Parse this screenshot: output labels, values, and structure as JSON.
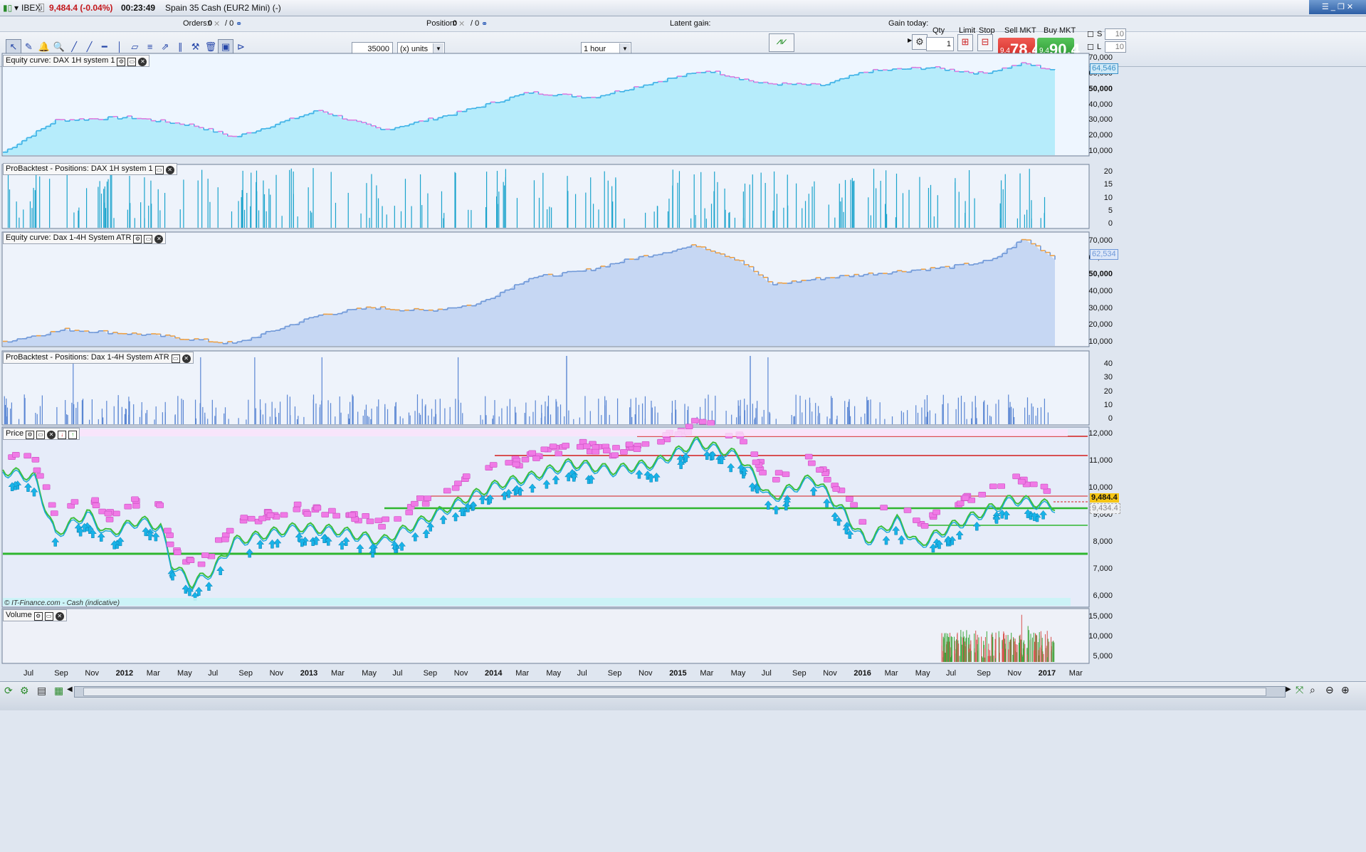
{
  "window": {
    "title_symbol": "IBEX",
    "price": "9,484.4 (-0.04%)",
    "time": "00:23:49",
    "instrument": "Spain 35 Cash (EUR2 Mini) (-)"
  },
  "info": {
    "orders_label": "Orders:",
    "orders_value": "0",
    "orders_sep": "/ 0",
    "position_label": "Position:",
    "position_value": "0",
    "position_sep": "/ 0",
    "latent_label": "Latent gain:",
    "latent_value": "-",
    "gain_label": "Gain today:",
    "gain_value": "-"
  },
  "toolbar": {
    "tools": [
      "pointer-tool",
      "eraser-tool",
      "alarm-tool",
      "zoom-tool",
      "line-tool",
      "trendline-tool",
      "horizontal-line-tool",
      "vertical-line-tool",
      "channel-tool",
      "fibonacci-tool",
      "arrows-tool",
      "parallel-tool",
      "magnet-tool",
      "delete-tool",
      "indicator-tool",
      "signal-tool"
    ],
    "units_value": "35000",
    "units_mode": "(x) units",
    "timeframe": "1 hour",
    "qty_label": "Qty",
    "qty_value": "1",
    "limit_label": "Limit",
    "stop_label": "Stop",
    "sell_label": "Sell MKT",
    "sell_small": "9,4",
    "sell_big": "78.4",
    "buy_label": "Buy MKT",
    "buy_small": "9,4",
    "buy_big": "90.4",
    "s_label": "S",
    "s_value": "10",
    "l_label": "L",
    "l_value": "10"
  },
  "panels": {
    "equity1": {
      "label": "Equity curve: DAX 1H system 1",
      "y_ticks": [
        "70,000",
        "60,000",
        "50,000",
        "40,000",
        "30,000",
        "20,000",
        "10,000"
      ],
      "last": "64,546",
      "line_color": "#3cb0e6",
      "fill_color": "#b6ecfb",
      "down_color": "#e07adf"
    },
    "positions1": {
      "label": "ProBacktest - Positions: DAX 1H system 1",
      "y_ticks": [
        "20",
        "15",
        "10",
        "5",
        "0"
      ],
      "bar_color": "#1aa3cc"
    },
    "equity2": {
      "label": "Equity curve: Dax 1-4H System ATR",
      "y_ticks": [
        "70,000",
        "60,000",
        "50,000",
        "40,000",
        "30,000",
        "20,000",
        "10,000"
      ],
      "last": "62,534",
      "line_color": "#6f98d8",
      "fill_color": "#c6d7f3",
      "down_color": "#f0a040"
    },
    "positions2": {
      "label": "ProBacktest - Positions: Dax 1-4H System ATR",
      "y_ticks": [
        "40",
        "30",
        "20",
        "10",
        "0"
      ],
      "bar_color": "#5a86d3"
    },
    "price": {
      "label": "Price",
      "y_ticks": [
        "12,000",
        "11,000",
        "10,000",
        "9,000",
        "8,000",
        "7,000",
        "6,000"
      ],
      "last": "9,484.4",
      "last2": "9,434.4",
      "footer": "© IT-Finance.com - Cash (indicative)"
    },
    "volume": {
      "label": "Volume",
      "y_ticks": [
        "15,000",
        "10,000",
        "5,000"
      ]
    }
  },
  "x_axis": [
    {
      "t": "Jul",
      "yr": false
    },
    {
      "t": "Sep",
      "yr": false
    },
    {
      "t": "Nov",
      "yr": false
    },
    {
      "t": "2012",
      "yr": true
    },
    {
      "t": "Mar",
      "yr": false
    },
    {
      "t": "May",
      "yr": false
    },
    {
      "t": "Jul",
      "yr": false
    },
    {
      "t": "Sep",
      "yr": false
    },
    {
      "t": "Nov",
      "yr": false
    },
    {
      "t": "2013",
      "yr": true
    },
    {
      "t": "Mar",
      "yr": false
    },
    {
      "t": "May",
      "yr": false
    },
    {
      "t": "Jul",
      "yr": false
    },
    {
      "t": "Sep",
      "yr": false
    },
    {
      "t": "Nov",
      "yr": false
    },
    {
      "t": "2014",
      "yr": true
    },
    {
      "t": "Mar",
      "yr": false
    },
    {
      "t": "May",
      "yr": false
    },
    {
      "t": "Jul",
      "yr": false
    },
    {
      "t": "Sep",
      "yr": false
    },
    {
      "t": "Nov",
      "yr": false
    },
    {
      "t": "2015",
      "yr": true
    },
    {
      "t": "Mar",
      "yr": false
    },
    {
      "t": "May",
      "yr": false
    },
    {
      "t": "Jul",
      "yr": false
    },
    {
      "t": "Sep",
      "yr": false
    },
    {
      "t": "Nov",
      "yr": false
    },
    {
      "t": "2016",
      "yr": true
    },
    {
      "t": "Mar",
      "yr": false
    },
    {
      "t": "May",
      "yr": false
    },
    {
      "t": "Jul",
      "yr": false
    },
    {
      "t": "Sep",
      "yr": false
    },
    {
      "t": "Nov",
      "yr": false
    },
    {
      "t": "2017",
      "yr": true
    },
    {
      "t": "Mar",
      "yr": false
    }
  ],
  "colors": {
    "support_green": "#2fb62f",
    "resistance_red": "#d41c1c",
    "sell_red": "#d9302c",
    "buy_green": "#2f9c34",
    "marker_pink": "#f07ae6",
    "arrow_cyan": "#18b3e8"
  }
}
